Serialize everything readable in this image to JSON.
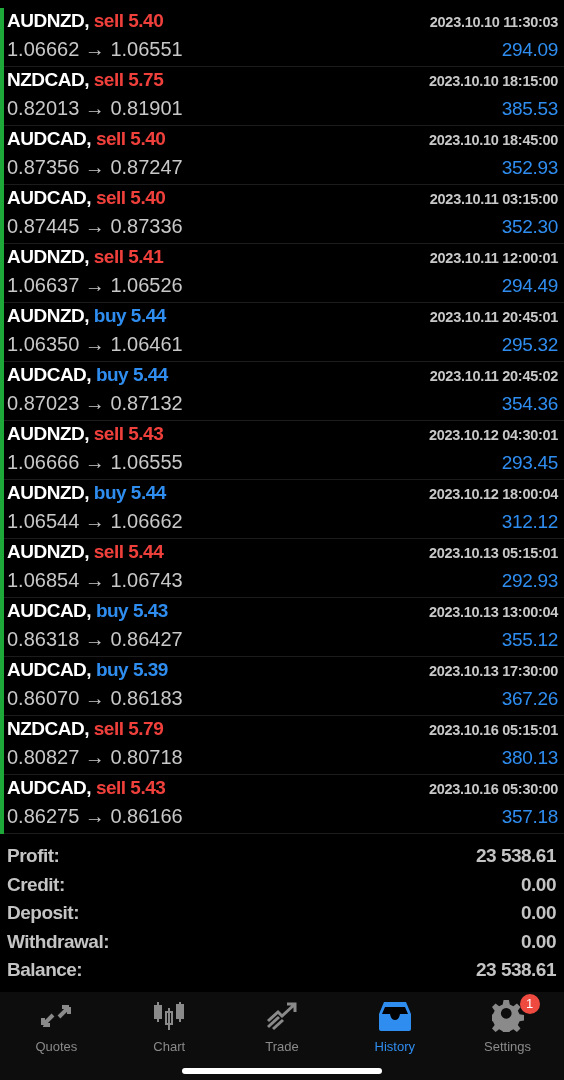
{
  "deals": [
    {
      "symbol": "AUDNZD,",
      "kind": "sell",
      "deal": "sell 5.40",
      "prices": "1.06662 → 1.06551",
      "time": "2023.10.10 11:30:03",
      "profit": "294.09"
    },
    {
      "symbol": "NZDCAD,",
      "kind": "sell",
      "deal": "sell 5.75",
      "prices": "0.82013 → 0.81901",
      "time": "2023.10.10 18:15:00",
      "profit": "385.53"
    },
    {
      "symbol": "AUDCAD,",
      "kind": "sell",
      "deal": "sell 5.40",
      "prices": "0.87356 → 0.87247",
      "time": "2023.10.10 18:45:00",
      "profit": "352.93"
    },
    {
      "symbol": "AUDCAD,",
      "kind": "sell",
      "deal": "sell 5.40",
      "prices": "0.87445 → 0.87336",
      "time": "2023.10.11 03:15:00",
      "profit": "352.30"
    },
    {
      "symbol": "AUDNZD,",
      "kind": "sell",
      "deal": "sell 5.41",
      "prices": "1.06637 → 1.06526",
      "time": "2023.10.11 12:00:01",
      "profit": "294.49"
    },
    {
      "symbol": "AUDNZD,",
      "kind": "buy",
      "deal": "buy 5.44",
      "prices": "1.06350 → 1.06461",
      "time": "2023.10.11 20:45:01",
      "profit": "295.32"
    },
    {
      "symbol": "AUDCAD,",
      "kind": "buy",
      "deal": "buy 5.44",
      "prices": "0.87023 → 0.87132",
      "time": "2023.10.11 20:45:02",
      "profit": "354.36"
    },
    {
      "symbol": "AUDNZD,",
      "kind": "sell",
      "deal": "sell 5.43",
      "prices": "1.06666 → 1.06555",
      "time": "2023.10.12 04:30:01",
      "profit": "293.45"
    },
    {
      "symbol": "AUDNZD,",
      "kind": "buy",
      "deal": "buy 5.44",
      "prices": "1.06544 → 1.06662",
      "time": "2023.10.12 18:00:04",
      "profit": "312.12"
    },
    {
      "symbol": "AUDNZD,",
      "kind": "sell",
      "deal": "sell 5.44",
      "prices": "1.06854 → 1.06743",
      "time": "2023.10.13 05:15:01",
      "profit": "292.93"
    },
    {
      "symbol": "AUDCAD,",
      "kind": "buy",
      "deal": "buy 5.43",
      "prices": "0.86318 → 0.86427",
      "time": "2023.10.13 13:00:04",
      "profit": "355.12"
    },
    {
      "symbol": "AUDCAD,",
      "kind": "buy",
      "deal": "buy 5.39",
      "prices": "0.86070 → 0.86183",
      "time": "2023.10.13 17:30:00",
      "profit": "367.26"
    },
    {
      "symbol": "NZDCAD,",
      "kind": "sell",
      "deal": "sell 5.79",
      "prices": "0.80827 → 0.80718",
      "time": "2023.10.16 05:15:01",
      "profit": "380.13"
    },
    {
      "symbol": "AUDCAD,",
      "kind": "sell",
      "deal": "sell 5.43",
      "prices": "0.86275 → 0.86166",
      "time": "2023.10.16 05:30:00",
      "profit": "357.18"
    }
  ],
  "summary": [
    {
      "label": "Profit:",
      "value": "23 538.61"
    },
    {
      "label": "Credit:",
      "value": "0.00"
    },
    {
      "label": "Deposit:",
      "value": "0.00"
    },
    {
      "label": "Withdrawal:",
      "value": "0.00"
    },
    {
      "label": "Balance:",
      "value": "23 538.61"
    }
  ],
  "tabs": [
    {
      "kind": "quotes",
      "label": "Quotes",
      "selected": false
    },
    {
      "kind": "chart",
      "label": "Chart",
      "selected": false
    },
    {
      "kind": "trade",
      "label": "Trade",
      "selected": false
    },
    {
      "kind": "history",
      "label": "History",
      "selected": true
    },
    {
      "kind": "settings",
      "label": "Settings",
      "selected": false,
      "badge": "1"
    }
  ]
}
